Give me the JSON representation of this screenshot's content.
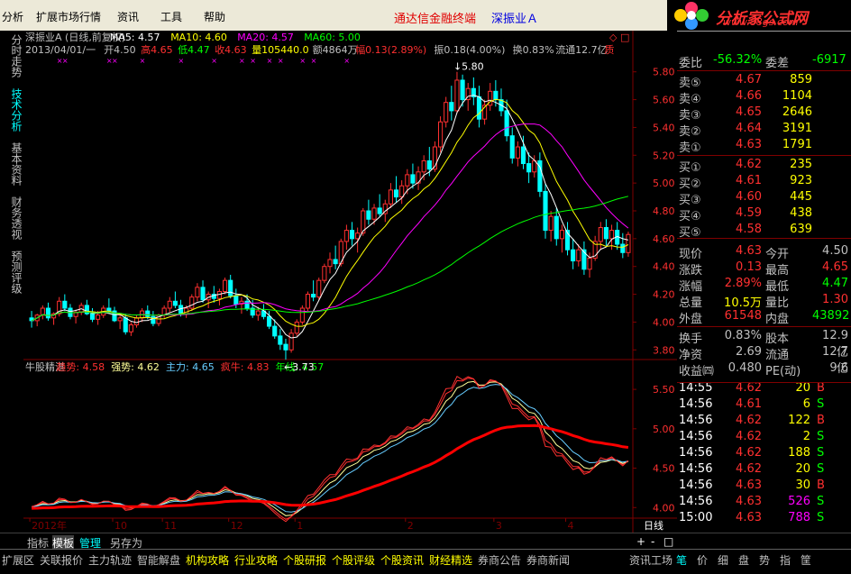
{
  "menubar": {
    "items": [
      "分析",
      "扩展市场行情",
      "资讯",
      "工具",
      "帮助"
    ],
    "title_red": "通达信金融终端",
    "title_blue": "深振业Ａ"
  },
  "logo": {
    "text": "分析家公式网",
    "url": "www.88gs.com"
  },
  "leftnav": [
    {
      "label": "分时走势",
      "active": false
    },
    {
      "label": "技术分析",
      "active": true
    },
    {
      "label": "基本资料",
      "active": false
    },
    {
      "label": "财务透视",
      "active": false
    },
    {
      "label": "预测评级",
      "active": false
    }
  ],
  "main_header": {
    "line1": [
      {
        "t": "深振业A (日线,前复权)",
        "c": "#c0c0c0"
      },
      {
        "t": "MA5: 4.57",
        "c": "#ffffff"
      },
      {
        "t": "MA10: 4.60",
        "c": "#ffff00"
      },
      {
        "t": "MA20: 4.57",
        "c": "#ff00ff"
      },
      {
        "t": "MA60: 5.00",
        "c": "#00ff00"
      }
    ],
    "line2": [
      {
        "t": "2013/04/01/一",
        "c": "#c0c0c0"
      },
      {
        "t": "开4.50",
        "c": "#c0c0c0"
      },
      {
        "t": "高4.65",
        "c": "#ff3030"
      },
      {
        "t": "低4.47",
        "c": "#00ff00"
      },
      {
        "t": "收4.63",
        "c": "#ff3030"
      },
      {
        "t": "量105440.0",
        "c": "#ffff00"
      },
      {
        "t": "额4864万",
        "c": "#c0c0c0"
      },
      {
        "t": "幅0.13(2.89%)",
        "c": "#ff3030"
      },
      {
        "t": "振0.18(4.00%)",
        "c": "#c0c0c0"
      },
      {
        "t": "换0.83%",
        "c": "#c0c0c0"
      },
      {
        "t": "流通12.7亿",
        "c": "#c0c0c0"
      },
      {
        "t": "质",
        "c": "#ff3030"
      }
    ],
    "corner": "◇ □"
  },
  "indicator_header": [
    {
      "t": "牛股精湛",
      "c": "#c0c0c0"
    },
    {
      "t": "趋势: 4.58",
      "c": "#ff3030"
    },
    {
      "t": "强势: 4.62",
      "c": "#ffff99"
    },
    {
      "t": "主力: 4.65",
      "c": "#66ccff"
    },
    {
      "t": "疯牛: 4.83",
      "c": "#ff3030"
    },
    {
      "t": "年线: 4.57",
      "c": "#00ff00"
    }
  ],
  "chart_data": {
    "type": "candlestick",
    "price_axis": {
      "ticks": [
        "5.80",
        "5.60",
        "5.40",
        "5.20",
        "5.00",
        "4.80",
        "4.60",
        "4.40",
        "4.20",
        "4.00",
        "3.80"
      ],
      "range": [
        3.75,
        5.85
      ]
    },
    "indicator_axis": {
      "ticks": [
        "5.50",
        "5.00",
        "4.50",
        "4.00"
      ],
      "range": [
        3.9,
        5.65
      ]
    },
    "annotations": {
      "high": "5.80",
      "low": "3.73"
    },
    "x_labels": [
      "2012年",
      "10",
      "11",
      "12",
      "1",
      "2",
      "3",
      "4"
    ],
    "candles": [
      [
        4.03,
        4.08,
        3.96,
        4.01
      ],
      [
        4.01,
        4.06,
        3.97,
        4.05
      ],
      [
        4.05,
        4.12,
        4.02,
        4.1
      ],
      [
        4.1,
        4.14,
        4.01,
        4.03
      ],
      [
        4.03,
        4.07,
        3.98,
        4.06
      ],
      [
        4.06,
        4.18,
        4.04,
        4.15
      ],
      [
        4.15,
        4.2,
        4.08,
        4.1
      ],
      [
        4.1,
        4.13,
        4.02,
        4.04
      ],
      [
        4.04,
        4.09,
        3.99,
        4.07
      ],
      [
        4.07,
        4.14,
        4.05,
        4.12
      ],
      [
        4.12,
        4.16,
        4.05,
        4.06
      ],
      [
        4.06,
        4.1,
        4.0,
        4.02
      ],
      [
        4.02,
        4.08,
        3.98,
        4.05
      ],
      [
        4.05,
        4.12,
        4.03,
        4.1
      ],
      [
        4.1,
        4.17,
        4.06,
        4.08
      ],
      [
        4.08,
        4.11,
        4.0,
        4.01
      ],
      [
        4.01,
        4.05,
        3.95,
        4.03
      ],
      [
        4.03,
        4.06,
        3.91,
        3.93
      ],
      [
        3.93,
        4.0,
        3.9,
        3.98
      ],
      [
        3.98,
        4.05,
        3.96,
        4.03
      ],
      [
        4.03,
        4.1,
        4.0,
        4.08
      ],
      [
        4.08,
        4.12,
        4.02,
        4.04
      ],
      [
        4.04,
        4.08,
        3.97,
        3.99
      ],
      [
        3.99,
        4.06,
        3.97,
        4.05
      ],
      [
        4.05,
        4.12,
        4.03,
        4.1
      ],
      [
        4.1,
        4.18,
        4.07,
        4.15
      ],
      [
        4.15,
        4.22,
        4.1,
        4.12
      ],
      [
        4.12,
        4.16,
        4.04,
        4.06
      ],
      [
        4.06,
        4.12,
        4.03,
        4.1
      ],
      [
        4.1,
        4.2,
        4.08,
        4.18
      ],
      [
        4.18,
        4.28,
        4.15,
        4.25
      ],
      [
        4.25,
        4.3,
        4.14,
        4.16
      ],
      [
        4.16,
        4.22,
        4.1,
        4.2
      ],
      [
        4.2,
        4.26,
        4.14,
        4.17
      ],
      [
        4.17,
        4.24,
        4.12,
        4.22
      ],
      [
        4.22,
        4.32,
        4.2,
        4.3
      ],
      [
        4.3,
        4.34,
        4.17,
        4.19
      ],
      [
        4.19,
        4.24,
        4.1,
        4.13
      ],
      [
        4.13,
        4.18,
        4.06,
        4.15
      ],
      [
        4.15,
        4.2,
        4.08,
        4.1
      ],
      [
        4.1,
        4.16,
        4.03,
        4.05
      ],
      [
        4.05,
        4.11,
        4.01,
        4.08
      ],
      [
        4.08,
        4.13,
        4.02,
        4.04
      ],
      [
        4.04,
        4.08,
        3.95,
        3.97
      ],
      [
        3.97,
        4.02,
        3.88,
        3.9
      ],
      [
        3.9,
        3.95,
        3.8,
        3.84
      ],
      [
        3.84,
        3.88,
        3.73,
        3.8
      ],
      [
        3.8,
        3.95,
        3.78,
        3.92
      ],
      [
        3.92,
        4.02,
        3.9,
        4.0
      ],
      [
        4.0,
        4.12,
        3.98,
        4.1
      ],
      [
        4.1,
        4.22,
        4.08,
        4.2
      ],
      [
        4.2,
        4.3,
        4.15,
        4.18
      ],
      [
        4.18,
        4.32,
        4.16,
        4.3
      ],
      [
        4.3,
        4.42,
        4.28,
        4.4
      ],
      [
        4.4,
        4.5,
        4.35,
        4.45
      ],
      [
        4.45,
        4.55,
        4.38,
        4.42
      ],
      [
        4.42,
        4.6,
        4.4,
        4.58
      ],
      [
        4.58,
        4.7,
        4.52,
        4.66
      ],
      [
        4.66,
        4.72,
        4.55,
        4.6
      ],
      [
        4.6,
        4.68,
        4.5,
        4.64
      ],
      [
        4.64,
        4.82,
        4.62,
        4.8
      ],
      [
        4.8,
        4.88,
        4.7,
        4.74
      ],
      [
        4.74,
        4.85,
        4.7,
        4.82
      ],
      [
        4.82,
        4.92,
        4.76,
        4.78
      ],
      [
        4.78,
        4.88,
        4.72,
        4.85
      ],
      [
        4.85,
        5.0,
        4.82,
        4.95
      ],
      [
        4.95,
        5.05,
        4.86,
        4.9
      ],
      [
        4.9,
        5.02,
        4.85,
        4.98
      ],
      [
        4.98,
        5.1,
        4.92,
        5.06
      ],
      [
        5.06,
        5.14,
        4.96,
        5.0
      ],
      [
        5.0,
        5.12,
        4.95,
        5.08
      ],
      [
        5.08,
        5.2,
        5.02,
        5.16
      ],
      [
        5.16,
        5.26,
        5.05,
        5.1
      ],
      [
        5.1,
        5.3,
        5.08,
        5.26
      ],
      [
        5.26,
        5.48,
        5.22,
        5.44
      ],
      [
        5.44,
        5.62,
        5.4,
        5.58
      ],
      [
        5.58,
        5.7,
        5.45,
        5.52
      ],
      [
        5.52,
        5.8,
        5.5,
        5.74
      ],
      [
        5.74,
        5.78,
        5.55,
        5.6
      ],
      [
        5.6,
        5.72,
        5.52,
        5.68
      ],
      [
        5.68,
        5.76,
        5.56,
        5.62
      ],
      [
        5.62,
        5.7,
        5.4,
        5.46
      ],
      [
        5.46,
        5.6,
        5.42,
        5.56
      ],
      [
        5.56,
        5.72,
        5.52,
        5.66
      ],
      [
        5.66,
        5.74,
        5.55,
        5.6
      ],
      [
        5.6,
        5.68,
        5.48,
        5.52
      ],
      [
        5.52,
        5.6,
        5.3,
        5.34
      ],
      [
        5.34,
        5.4,
        5.14,
        5.18
      ],
      [
        5.18,
        5.3,
        5.12,
        5.26
      ],
      [
        5.26,
        5.34,
        5.1,
        5.14
      ],
      [
        5.14,
        5.22,
        5.0,
        5.08
      ],
      [
        5.08,
        5.2,
        5.04,
        5.16
      ],
      [
        5.16,
        5.22,
        4.9,
        4.94
      ],
      [
        4.94,
        5.0,
        4.6,
        4.66
      ],
      [
        4.66,
        4.8,
        4.58,
        4.76
      ],
      [
        4.76,
        4.82,
        4.55,
        4.6
      ],
      [
        4.6,
        4.7,
        4.5,
        4.66
      ],
      [
        4.66,
        4.72,
        4.48,
        4.52
      ],
      [
        4.52,
        4.6,
        4.38,
        4.44
      ],
      [
        4.44,
        4.56,
        4.4,
        4.52
      ],
      [
        4.52,
        4.58,
        4.34,
        4.38
      ],
      [
        4.38,
        4.5,
        4.32,
        4.46
      ],
      [
        4.46,
        4.62,
        4.44,
        4.58
      ],
      [
        4.58,
        4.72,
        4.52,
        4.68
      ],
      [
        4.68,
        4.74,
        4.55,
        4.6
      ],
      [
        4.6,
        4.7,
        4.52,
        4.66
      ],
      [
        4.66,
        4.72,
        4.52,
        4.56
      ],
      [
        4.56,
        4.64,
        4.46,
        4.5
      ],
      [
        4.5,
        4.65,
        4.47,
        4.63
      ]
    ],
    "indicator_series": [
      {
        "name": "趋势",
        "color": "#ff3030"
      },
      {
        "name": "强势",
        "color": "#ffff99"
      },
      {
        "name": "主力",
        "color": "#66ccff"
      },
      {
        "name": "疯牛",
        "color": "#ff3030"
      },
      {
        "name": "年线",
        "color": "#00ff00"
      }
    ],
    "colors": {
      "up": "#ff3030",
      "down": "#00ffff",
      "ma5": "#ffffff",
      "ma10": "#ffff00",
      "ma20": "#ff00ff",
      "ma60": "#00ff00"
    }
  },
  "quote": {
    "ratio": [
      {
        "l": "委比",
        "v": "-56.32%",
        "c": "#00ff00"
      },
      {
        "l": "委差",
        "v": "-6917",
        "c": "#00ff00"
      }
    ],
    "sells": [
      {
        "l": "卖⑤",
        "p": "4.67",
        "v": "859"
      },
      {
        "l": "卖④",
        "p": "4.66",
        "v": "1104"
      },
      {
        "l": "卖③",
        "p": "4.65",
        "v": "2646"
      },
      {
        "l": "卖②",
        "p": "4.64",
        "v": "3191"
      },
      {
        "l": "卖①",
        "p": "4.63",
        "v": "1791"
      }
    ],
    "buys": [
      {
        "l": "买①",
        "p": "4.62",
        "v": "235"
      },
      {
        "l": "买②",
        "p": "4.61",
        "v": "923"
      },
      {
        "l": "买③",
        "p": "4.60",
        "v": "445"
      },
      {
        "l": "买④",
        "p": "4.59",
        "v": "438"
      },
      {
        "l": "买⑤",
        "p": "4.58",
        "v": "639"
      }
    ],
    "stats": [
      [
        {
          "l": "现价",
          "v": "4.63",
          "c": "#ff3030"
        },
        {
          "l": "今开",
          "v": "4.50",
          "c": "#c0c0c0"
        }
      ],
      [
        {
          "l": "涨跌",
          "v": "0.13",
          "c": "#ff3030"
        },
        {
          "l": "最高",
          "v": "4.65",
          "c": "#ff3030"
        }
      ],
      [
        {
          "l": "涨幅",
          "v": "2.89%",
          "c": "#ff3030"
        },
        {
          "l": "最低",
          "v": "4.47",
          "c": "#00ff00"
        }
      ],
      [
        {
          "l": "总量",
          "v": "10.5万",
          "c": "#ffff00"
        },
        {
          "l": "量比",
          "v": "1.30",
          "c": "#ff3030"
        }
      ],
      [
        {
          "l": "外盘",
          "v": "61548",
          "c": "#ff3030"
        },
        {
          "l": "内盘",
          "v": "43892",
          "c": "#00ff00"
        }
      ]
    ],
    "info": [
      [
        {
          "l": "换手",
          "v": "0.83%"
        },
        {
          "l": "股本",
          "v": "12.9亿"
        }
      ],
      [
        {
          "l": "净资",
          "v": "2.69"
        },
        {
          "l": "流通",
          "v": "12.7亿"
        }
      ],
      [
        {
          "l": "收益㈣",
          "v": "0.480"
        },
        {
          "l": "PE(动)",
          "v": "9.6"
        }
      ]
    ],
    "ticks": [
      {
        "t": "14:55",
        "p": "4.62",
        "v": "20",
        "d": "B"
      },
      {
        "t": "14:56",
        "p": "4.61",
        "v": "6",
        "d": "S"
      },
      {
        "t": "14:56",
        "p": "4.62",
        "v": "122",
        "d": "B"
      },
      {
        "t": "14:56",
        "p": "4.62",
        "v": "2",
        "d": "S"
      },
      {
        "t": "14:56",
        "p": "4.62",
        "v": "188",
        "d": "S"
      },
      {
        "t": "14:56",
        "p": "4.62",
        "v": "20",
        "d": "S"
      },
      {
        "t": "14:56",
        "p": "4.63",
        "v": "30",
        "d": "B"
      },
      {
        "t": "14:56",
        "p": "4.63",
        "v": "526",
        "d": "S"
      },
      {
        "t": "15:00",
        "p": "4.63",
        "v": "788",
        "d": "S"
      }
    ]
  },
  "xaxis_right": "日线",
  "tabs": [
    "指标",
    "模板",
    "管理",
    "另存为"
  ],
  "zoom_btns": [
    "+",
    "-",
    "□"
  ],
  "bottom_tabs": [
    {
      "t": "扩展区",
      "c": "#c0c0c0"
    },
    {
      "t": "关联报价",
      "c": "#c0c0c0"
    },
    {
      "t": "主力轨迹",
      "c": "#c0c0c0"
    },
    {
      "t": "智能解盘",
      "c": "#c0c0c0"
    },
    {
      "t": "机构攻略",
      "c": "#ffff00"
    },
    {
      "t": "行业攻略",
      "c": "#ffff00"
    },
    {
      "t": "个股研报",
      "c": "#ffff00"
    },
    {
      "t": "个股评级",
      "c": "#ffff00"
    },
    {
      "t": "个股资讯",
      "c": "#ffff00"
    },
    {
      "t": "财经精选",
      "c": "#ffff00"
    },
    {
      "t": "券商公告",
      "c": "#c0c0c0"
    },
    {
      "t": "券商新闻",
      "c": "#c0c0c0"
    }
  ],
  "right_tabs": [
    "资讯工场",
    "笔",
    "价",
    "细",
    "盘",
    "势",
    "指",
    "筐"
  ]
}
